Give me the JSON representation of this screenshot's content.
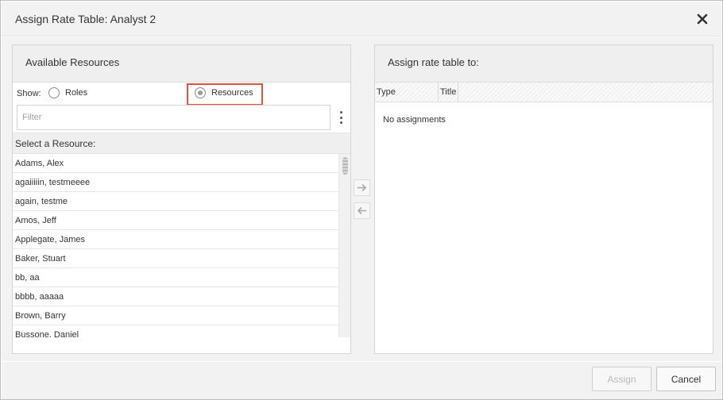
{
  "dialog": {
    "title": "Assign Rate Table: Analyst 2",
    "close_icon": "close-icon"
  },
  "left_panel": {
    "title": "Available Resources",
    "show_label": "Show:",
    "radio_roles": "Roles",
    "radio_resources": "Resources",
    "selected_radio": "Resources",
    "filter_placeholder": "Filter",
    "filter_value": "",
    "select_heading": "Select a Resource:",
    "items": [
      "Adams, Alex",
      "agaiiiiin, testmeeee",
      "again, testme",
      "Amos, Jeff",
      "Applegate, James",
      "Baker, Stuart",
      "bb, aa",
      "bbbb, aaaaa",
      "Brown, Barry",
      "Bussone, Daniel"
    ]
  },
  "right_panel": {
    "title": "Assign rate table to:",
    "columns": [
      "Type",
      "Title"
    ],
    "empty_text": "No assignments"
  },
  "footer": {
    "assign_label": "Assign",
    "cancel_label": "Cancel"
  },
  "colors": {
    "highlight": "#e8503a",
    "panel_header": "#efefef",
    "disabled_text": "#b9b9b9"
  }
}
